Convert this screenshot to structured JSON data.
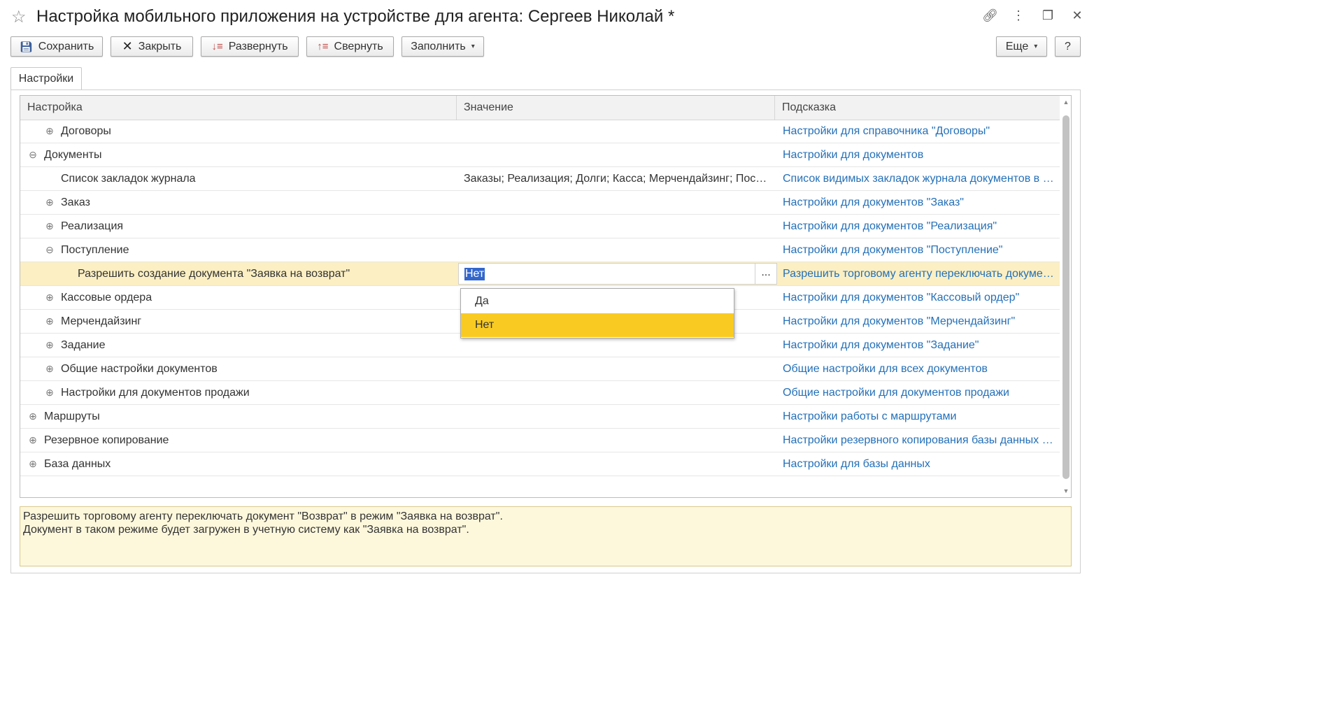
{
  "window": {
    "title": "Настройка мобильного приложения на устройстве для агента: Сергеев Николай *",
    "star_icon": "star-icon",
    "link_icon": "link-icon",
    "more_icon": "more-vertical-icon",
    "restore_icon": "restore-icon",
    "close_icon": "close-icon"
  },
  "toolbar": {
    "save_label": "Сохранить",
    "close_label": "Закрыть",
    "expand_label": "Развернуть",
    "collapse_label": "Свернуть",
    "fill_label": "Заполнить",
    "more_label": "Еще",
    "help_label": "?"
  },
  "tabs": [
    {
      "label": "Настройки"
    }
  ],
  "table": {
    "columns": [
      "Настройка",
      "Значение",
      "Подсказка"
    ],
    "rows": [
      {
        "name": "Договоры",
        "level": 1,
        "toggle": "⊕",
        "value": "",
        "hint": "Настройки для справочника \"Договоры\""
      },
      {
        "name": "Документы",
        "level": 0,
        "toggle": "⊖",
        "value": "",
        "hint": "Настройки для документов"
      },
      {
        "name": "Список закладок журнала",
        "level": 1,
        "toggle": "",
        "value": "Заказы; Реализация; Долги; Касса; Мерчендайзинг; Поступление",
        "hint": "Список видимых закладок журнала документов в мобильном приложении"
      },
      {
        "name": "Заказ",
        "level": 1,
        "toggle": "⊕",
        "value": "",
        "hint": "Настройки для документов \"Заказ\""
      },
      {
        "name": "Реализация",
        "level": 1,
        "toggle": "⊕",
        "value": "",
        "hint": "Настройки для документов \"Реализация\""
      },
      {
        "name": "Поступление",
        "level": 1,
        "toggle": "⊖",
        "value": "",
        "hint": "Настройки для документов \"Поступление\""
      },
      {
        "name": "Разрешить создание документа \"Заявка на возврат\"",
        "level": 2,
        "toggle": "",
        "value": "Нет",
        "hint": "Разрешить торговому агенту переключать документ \"Возврат\"",
        "selected": true
      },
      {
        "name": "Кассовые ордера",
        "level": 1,
        "toggle": "⊕",
        "value": "",
        "hint": "Настройки для документов \"Кассовый ордер\""
      },
      {
        "name": "Мерчендайзинг",
        "level": 1,
        "toggle": "⊕",
        "value": "",
        "hint": "Настройки для документов \"Мерчендайзинг\""
      },
      {
        "name": "Задание",
        "level": 1,
        "toggle": "⊕",
        "value": "",
        "hint": "Настройки для документов \"Задание\""
      },
      {
        "name": "Общие настройки документов",
        "level": 1,
        "toggle": "⊕",
        "value": "",
        "hint": "Общие настройки для всех документов"
      },
      {
        "name": "Настройки для документов продажи",
        "level": 1,
        "toggle": "⊕",
        "value": "",
        "hint": "Общие настройки для документов продажи"
      },
      {
        "name": "Маршруты",
        "level": 0,
        "toggle": "⊕",
        "value": "",
        "hint": "Настройки работы с маршрутами"
      },
      {
        "name": "Резервное копирование",
        "level": 0,
        "toggle": "⊕",
        "value": "",
        "hint": "Настройки резервного копирования базы данных мобильного приложения"
      },
      {
        "name": "База данных",
        "level": 0,
        "toggle": "⊕",
        "value": "",
        "hint": "Настройки для базы данных"
      }
    ],
    "edit_dots": "..."
  },
  "dropdown": {
    "options": [
      "Да",
      "Нет"
    ],
    "selected": "Нет"
  },
  "note": {
    "line1": "Разрешить торговому агенту переключать документ \"Возврат\" в режим \"Заявка на возврат\".",
    "line2": "Документ в таком режиме будет загружен в учетную систему как \"Заявка на возврат\"."
  },
  "colors": {
    "hint_link": "#2470b8",
    "selected_row": "#fbefc3",
    "dropdown_active": "#f9cb22",
    "value_selection": "#3366cc",
    "note_bg": "#fdf8dc"
  }
}
